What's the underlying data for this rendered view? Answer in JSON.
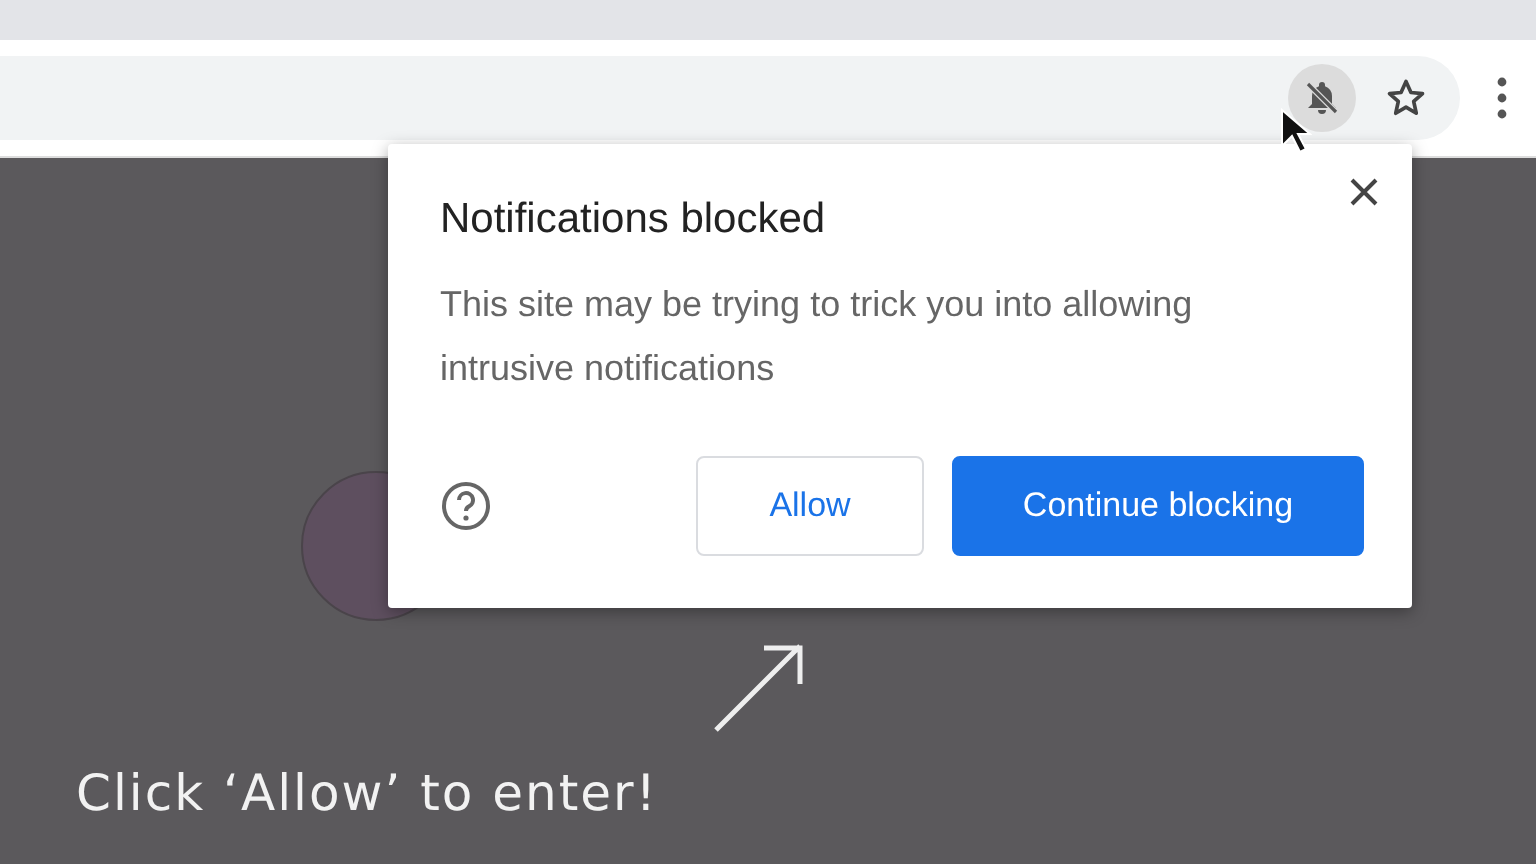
{
  "popup": {
    "title": "Notifications blocked",
    "message": "This site may be trying to trick you into allowing intrusive notifications",
    "buttons": [
      {
        "label": "Allow",
        "kind": "secondary"
      },
      {
        "label": "Continue blocking",
        "kind": "primary"
      }
    ]
  },
  "page": {
    "caption": "Click ‘Allow’ to enter!"
  }
}
